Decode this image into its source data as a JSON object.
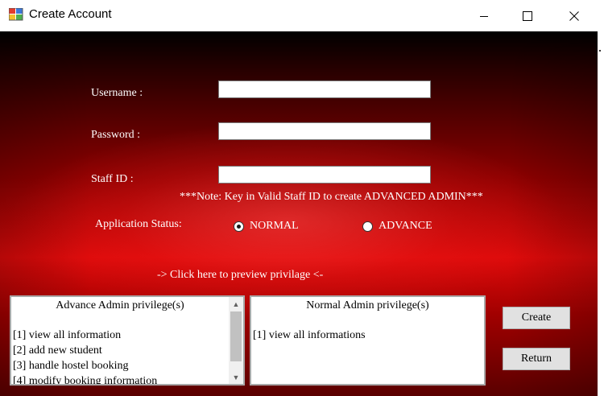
{
  "window": {
    "title": "Create Account",
    "controls": {
      "minimize_icon": "minimize-icon",
      "maximize_icon": "maximize-icon",
      "close_icon": "close-icon"
    }
  },
  "form": {
    "username_label": "Username :",
    "username_value": "",
    "password_label": "Password :",
    "password_value": "",
    "staff_id_label": "Staff ID :",
    "staff_id_value": "",
    "note": "***Note: Key in Valid Staff ID to create ADVANCED ADMIN***",
    "status_label": "Application Status:",
    "status_options": [
      {
        "label": "NORMAL",
        "checked": true
      },
      {
        "label": "ADVANCE",
        "checked": false
      }
    ],
    "preview_link": "-> Click here to preview privilage <-"
  },
  "privileges": {
    "advance": {
      "heading": "Advance Admin privilege(s)",
      "items": [
        "[1] view all information",
        "[2] add new student",
        "[3] handle hostel booking",
        "[4] modify booking information"
      ]
    },
    "normal": {
      "heading": "Normal Admin privilege(s)",
      "items": [
        "[1] view all informations"
      ]
    }
  },
  "buttons": {
    "create": "Create",
    "return": "Return"
  },
  "colors": {
    "background_dark": "#000000",
    "background_red": "#dd0a0a",
    "button_face": "#e1e1e1"
  }
}
